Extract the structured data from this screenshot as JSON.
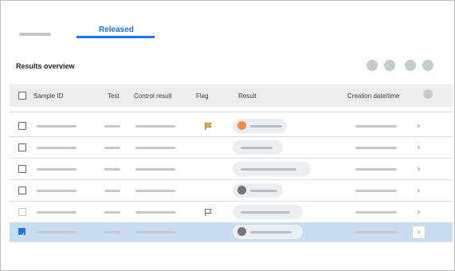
{
  "tabs": {
    "released_label": "Released"
  },
  "card": {
    "title": "Results overview"
  },
  "table": {
    "headers": {
      "sample_id": "Sample ID",
      "test": "Test",
      "control_result": "Control result",
      "flag": "Flag",
      "result": "Result",
      "creation_datetime": "Creation date/time"
    },
    "rows": [
      {
        "flag": "yellow",
        "result_dot": "orange",
        "checked": false
      },
      {
        "flag": "none",
        "result_dot": "none",
        "checked": false
      },
      {
        "flag": "none",
        "result_dot": "none",
        "checked": false
      },
      {
        "flag": "none",
        "result_dot": "gray",
        "checked": false
      },
      {
        "flag": "outline",
        "result_dot": "none",
        "checked": false
      },
      {
        "flag": "none",
        "result_dot": "gray",
        "checked": true,
        "selected": true
      }
    ]
  },
  "colors": {
    "accent": "#1a73e8",
    "selected_row": "#c9ddf0",
    "flag_yellow": "#f4b400",
    "dot_orange": "#ff8a3d",
    "dot_gray": "#757575"
  }
}
